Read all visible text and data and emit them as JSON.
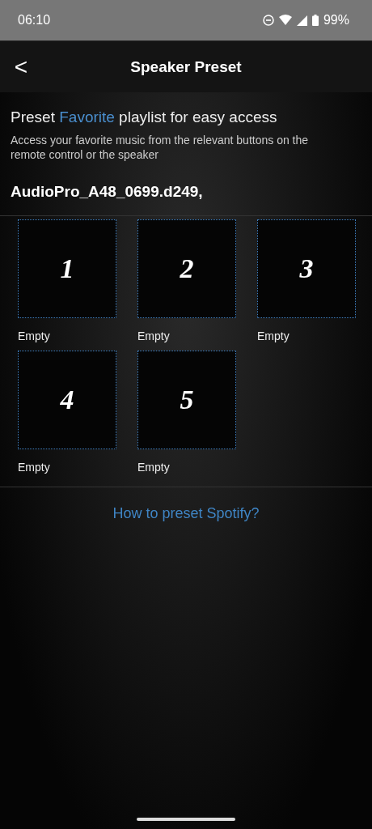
{
  "status_bar": {
    "time": "06:10",
    "battery": "99%"
  },
  "header": {
    "back": "<",
    "title": "Speaker Preset"
  },
  "intro": {
    "heading": [
      {
        "text": "Preset ",
        "highlight": false
      },
      {
        "text": "Favorite",
        "highlight": true
      },
      {
        "text": " playlist for easy access",
        "highlight": false
      }
    ],
    "description": "Access your favorite music from the relevant buttons on the remote control or the speaker"
  },
  "device": "AudioPro_A48_0699.d249,",
  "presets": [
    {
      "number": "1",
      "label": "Empty"
    },
    {
      "number": "2",
      "label": "Empty"
    },
    {
      "number": "3",
      "label": "Empty"
    },
    {
      "number": "4",
      "label": "Empty"
    },
    {
      "number": "5",
      "label": "Empty"
    }
  ],
  "help_link": "How to preset Spotify?"
}
